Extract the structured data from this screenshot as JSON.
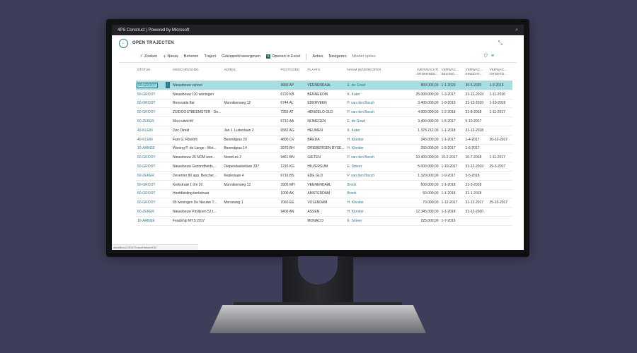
{
  "window": {
    "title": "4PS Construct | Powered by Microsoft"
  },
  "page": {
    "title": "OPEN TRAJECTEN"
  },
  "toolbar": {
    "zoeken": "Zoeken",
    "nieuw": "Nieuw",
    "beheren": "Beheren",
    "traject": "Traject",
    "gekoppeld": "Gekoppeld weergeven",
    "excel": "Openen in Excel",
    "acties": "Acties",
    "navigeren": "Navigeren",
    "minder": "Minder opties"
  },
  "columns": {
    "status": "STATUS",
    "omschrijving": "OMSCHRIJVING",
    "adres": "ADRES",
    "postcode": "POSTCODE",
    "plaats": "PLAATS",
    "verkoper": "NAAM IN/VERKOPER",
    "orderbedrag_1": "(VERWACHT)",
    "orderbedrag_2": "ORDERBED...",
    "begin_1": "VERWAC...",
    "begin_2": "BEGIND...",
    "eind_1": "VERWAC...",
    "eind_2": "EINDDAT...",
    "order_1": "VERWAC...",
    "order_2": "ORDERD..."
  },
  "rows": [
    {
      "status": "50-GROOT",
      "omschrijving": "Nieuwbouw school",
      "adres": "",
      "postcode": "3900 AP",
      "plaats": "VEENENDAAL",
      "verkoper": "E. de Graaf",
      "bedrag": "800.000,00",
      "begin": "1-1-2020",
      "eind": "30-6-2020",
      "order": "1-9-2016"
    },
    {
      "status": "50-GROOT",
      "omschrijving": "Nieuwbouw 110 woningen",
      "adres": "",
      "postcode": "6720 KB",
      "plaats": "BENNEKOM",
      "verkoper": "K. Kater",
      "bedrag": "25.000.000,00",
      "begin": "1-3-2017",
      "eind": "31-12-2019",
      "order": "1-11-2016"
    },
    {
      "status": "50-GROOT",
      "omschrijving": "Renovatie flat",
      "adres": "Munnikenweg 12",
      "postcode": "6744 AL",
      "plaats": "EDERVEEN",
      "verkoper": "P. van den Bosch",
      "bedrag": "3.400.000,00",
      "begin": "1-9-2019",
      "eind": "31-12-2019",
      "order": "1-10-2016"
    },
    {
      "status": "50-GROOT",
      "omschrijving": "ZUIDOOSTBEEMSTER - De...",
      "adres": "",
      "postcode": "7255 AT",
      "plaats": "HENGELO GLD",
      "verkoper": "P. van den Bosch",
      "bedrag": "4.000.000,00",
      "begin": "1-2-2018",
      "eind": "31-8-2018",
      "order": "1-11-2017"
    },
    {
      "status": "60-ZEKER",
      "omschrijving": "Mooi uitzicht!",
      "adres": "",
      "postcode": "6710 AA",
      "plaats": "NIJMEGEN",
      "verkoper": "E. de Graaf",
      "bedrag": "3.400.000,00",
      "begin": "1-5-2017",
      "eind": "5-10-2017",
      "order": ""
    },
    {
      "status": "40-KLEIN",
      "omschrijving": "Doc Direkt",
      "adres": "Jan J. Ludenlaan 2",
      "postcode": "6582 AG",
      "plaats": "HEUMEN",
      "verkoper": "K. Kater",
      "bedrag": "1.378.212,00",
      "begin": "1-1-2018",
      "eind": "31-12-2018",
      "order": ""
    },
    {
      "status": "40-KLEIN",
      "omschrijving": "Fam G. Roelofs",
      "adres": "Beemdgras 20",
      "postcode": "4800 CV",
      "plaats": "BREDA",
      "verkoper": "H. Klonker",
      "bedrag": "345.000,00",
      "begin": "1-1-2017",
      "eind": "1-4-2017",
      "order": "30-12-2017"
    },
    {
      "status": "10-AANGE",
      "omschrijving": "Woning P. de Lange - Mot...",
      "adres": "Beemdgras 14",
      "postcode": "3970 BH",
      "plaats": "DRIEBERGEN RYSE...",
      "verkoper": "H. Klonker",
      "bedrag": "250.000,00",
      "begin": "1-5-2017",
      "eind": "1-6-2017",
      "order": ""
    },
    {
      "status": "50-GROOT",
      "omschrijving": "Nieuwbouw 26 NOM won...",
      "adres": "Noord-es 2",
      "postcode": "9461 BN",
      "plaats": "GIETEN",
      "verkoper": "P. van den Bosch",
      "bedrag": "10.400.000,00",
      "begin": "15-2-2017",
      "eind": "16-7-2018",
      "order": "1-11-2017"
    },
    {
      "status": "50-GROOT",
      "omschrijving": "Nieuwbouw Gezondheids...",
      "adres": "Diependaalselaan 337",
      "postcode": "1215 KG",
      "plaats": "HILVERSUM",
      "verkoper": "E. Smeer",
      "bedrag": "5.000.000,00",
      "begin": "1-10-2017",
      "eind": "31-12-2019",
      "order": "29-3-2017"
    },
    {
      "status": "60-ZEKER",
      "omschrijving": "Deventer 80 app. Bescher...",
      "adres": "Kepleriaan 4",
      "postcode": "6716 BS",
      "plaats": "EDE GLD",
      "verkoper": "P. van den Bosch",
      "bedrag": "1.320.000,00",
      "begin": "1-9-2017",
      "eind": "5-5-2018",
      "order": ""
    },
    {
      "status": "50-GROOT",
      "omschrijving": "Kerkstraat 1 t/m 20",
      "adres": "Munnikenweg 12",
      "postcode": "3905 MH",
      "plaats": "VEENENDAAL",
      "verkoper": "Bronk",
      "bedrag": "500.000,00",
      "begin": "1-1-2018",
      "eind": "31-3-2018",
      "order": ""
    },
    {
      "status": "50-GROOT",
      "omschrijving": "Hoofdleiding kerkstraat",
      "adres": "",
      "postcode": "1000 AK",
      "plaats": "AMSTERDAM",
      "verkoper": "Bronk",
      "bedrag": "50.000,00",
      "begin": "1-1-2018",
      "eind": "31-1-2018",
      "order": ""
    },
    {
      "status": "50-GROOT",
      "omschrijving": "65 woningen De Nieuwe T...",
      "adres": "Morseweg 1",
      "postcode": "7060 EE",
      "plaats": "VOLENDAM",
      "verkoper": "H. Klonker",
      "bedrag": "70.000,00",
      "begin": "1-12-2017",
      "eind": "31-12-2017",
      "order": "25-10-2017"
    },
    {
      "status": "60-ZEKER",
      "omschrijving": "Nieuwbouw Paviljoen 52 t...",
      "adres": "",
      "postcode": "9400 AN",
      "plaats": "ASSEN",
      "verkoper": "H. Klonker",
      "bedrag": "12.345.000,00",
      "begin": "1-1-2018",
      "eind": "31-12-2020",
      "order": ""
    },
    {
      "status": "10-AANGE",
      "omschrijving": "Feadship MYS 2017",
      "adres": "",
      "postcode": "",
      "plaats": "MONACO",
      "verkoper": "E. Smeer",
      "bedrag": "225.000,00",
      "begin": "1-7-2019",
      "eind": "",
      "order": ""
    }
  ],
  "status_strip": "dansBoxxCISSOTrans/HetweriCM"
}
